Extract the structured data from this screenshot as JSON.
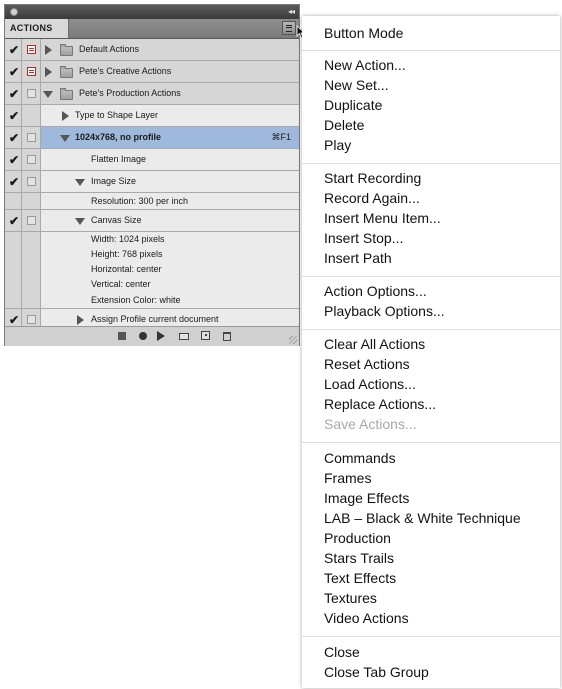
{
  "panel": {
    "tab_label": "ACTIONS",
    "collapse_glyph": "◂◂",
    "rows": [
      {
        "check": "✔",
        "dialog": "red",
        "label": "Default Actions"
      },
      {
        "check": "✔",
        "dialog": "red",
        "label": "Pete's Creative Actions"
      },
      {
        "check": "✔",
        "dialog": "empty",
        "label": "Pete's Production Actions"
      },
      {
        "check": "✔",
        "label": "Type to Shape Layer"
      },
      {
        "check": "✔",
        "label": "1024x768, no profile",
        "shortcut": "⌘F1"
      },
      {
        "check": "✔",
        "label": "Flatten Image"
      },
      {
        "check": "✔",
        "label": "Image Size",
        "details": [
          "Resolution: 300 per inch"
        ]
      },
      {
        "check": "✔",
        "label": "Canvas Size",
        "details": [
          "Width: 1024 pixels",
          "Height: 768 pixels",
          "Horizontal: center",
          "Vertical: center",
          "Extension Color: white"
        ]
      },
      {
        "check": "✔",
        "label": "Assign Profile current document"
      }
    ]
  },
  "menu": {
    "groups": [
      [
        "Button Mode"
      ],
      [
        "New Action...",
        "New Set...",
        "Duplicate",
        "Delete",
        "Play"
      ],
      [
        "Start Recording",
        "Record Again...",
        "Insert Menu Item...",
        "Insert Stop...",
        "Insert Path"
      ],
      [
        "Action Options...",
        "Playback Options..."
      ],
      [
        "Clear All Actions",
        "Reset Actions",
        "Load Actions...",
        "Replace Actions...",
        "Save Actions..."
      ],
      [
        "Commands",
        "Frames",
        "Image Effects",
        "LAB – Black & White Technique",
        "Production",
        "Stars Trails",
        "Text Effects",
        "Textures",
        "Video Actions"
      ],
      [
        "Close",
        "Close Tab Group"
      ]
    ],
    "disabled_items": [
      "Save Actions..."
    ]
  },
  "colors": {
    "selected_row": "#9fb9dc",
    "panel_bg": "#d6d6d6",
    "disabled_text": "#a8a8a8"
  }
}
